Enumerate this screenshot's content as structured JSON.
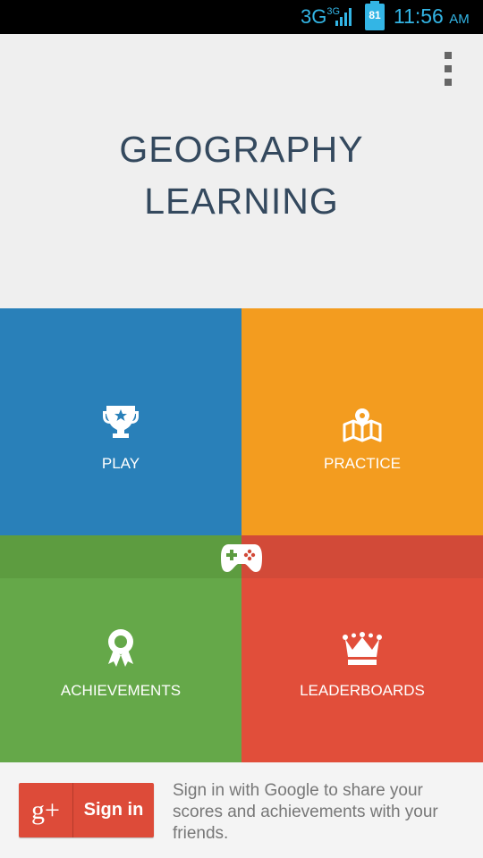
{
  "status_bar": {
    "network": "3G",
    "network_sup": "3G",
    "battery": "81",
    "time": "11:56",
    "am_pm": "AM",
    "accent_color": "#33b5e5"
  },
  "header": {
    "title_line1": "GEOGRAPHY",
    "title_line2": "LEARNING",
    "menu_icon": "overflow-menu-icon"
  },
  "tiles": {
    "play": {
      "label": "PLAY",
      "icon": "trophy-icon",
      "color": "#2980b9"
    },
    "practice": {
      "label": "PRACTICE",
      "icon": "map-pin-icon",
      "color": "#f39c1f"
    },
    "achievements": {
      "label": "ACHIEVEMENTS",
      "icon": "ribbon-icon",
      "color": "#65a849"
    },
    "leaderboards": {
      "label": "LEADERBOARDS",
      "icon": "crown-icon",
      "color": "#e14e3a"
    },
    "center_icon": "gamepad-icon"
  },
  "footer": {
    "gplus_logo": "g+",
    "signin_label": "Sign in",
    "description": "Sign in with Google to share your scores and achievements with your friends.",
    "button_color": "#dd4b39"
  }
}
